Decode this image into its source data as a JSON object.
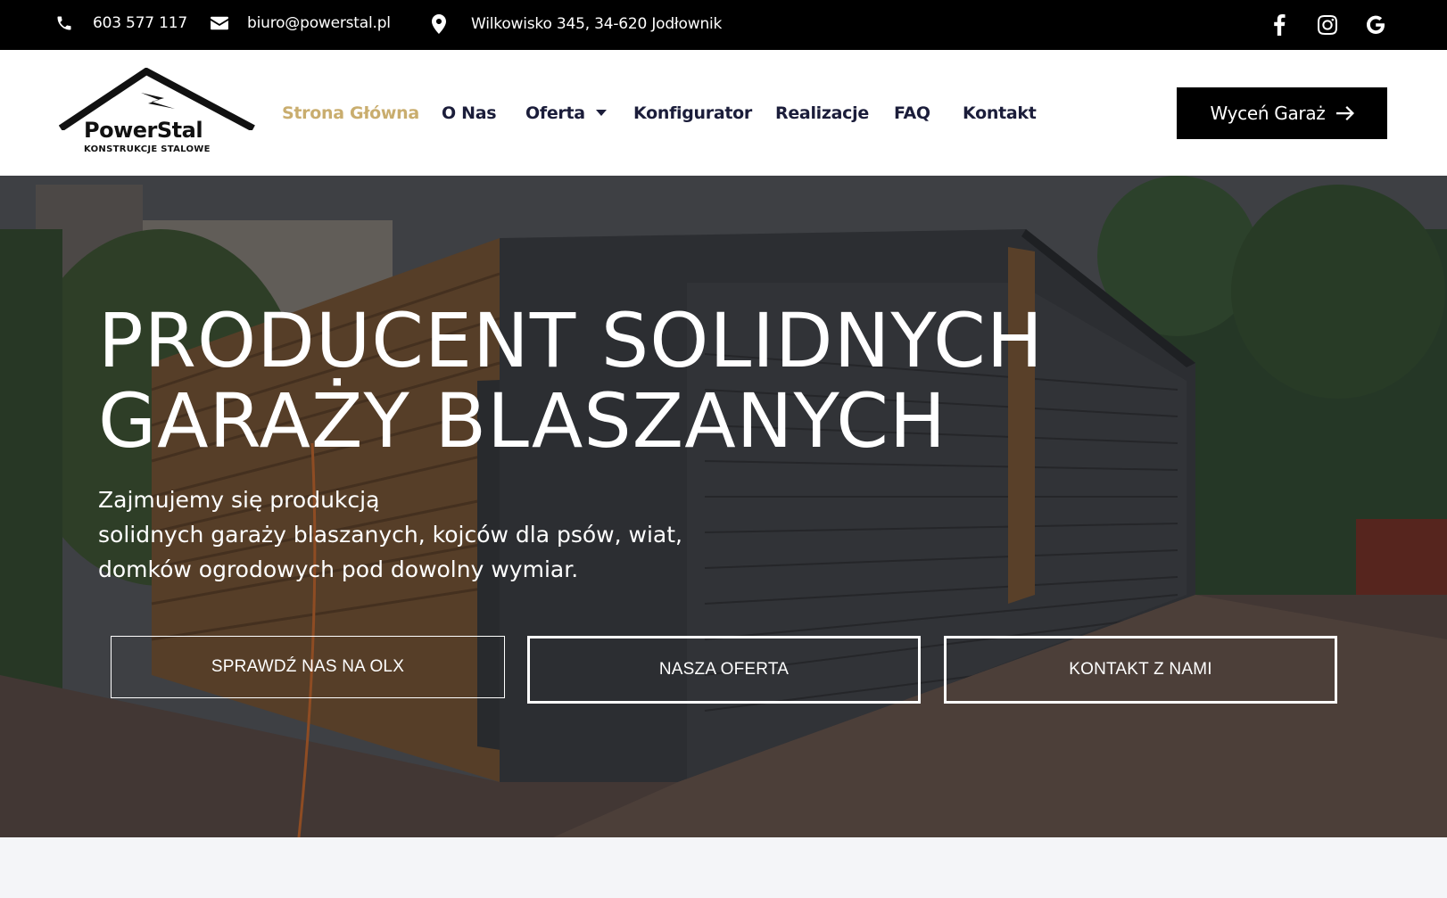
{
  "topbar": {
    "phone": "603 577 117",
    "email": "biuro@powerstal.pl",
    "address": "Wilkowisko 345, 34-620 Jodłownik"
  },
  "logo": {
    "brand": "PowerStal",
    "tagline": "KONSTRUKCJE STALOWE"
  },
  "nav": {
    "items": [
      {
        "label": "Strona Główna",
        "active": true
      },
      {
        "label": "O Nas"
      },
      {
        "label": "Oferta",
        "dropdown": true
      },
      {
        "label": "Konfigurator"
      },
      {
        "label": "Realizacje"
      },
      {
        "label": "FAQ"
      },
      {
        "label": "Kontakt"
      }
    ],
    "cta": "Wyceń Garaż"
  },
  "hero": {
    "title_line1": "PRODUCENT SOLIDNYCH",
    "title_line2": "GARAŻY BLASZANYCH",
    "sub_line1": "Zajmujemy się produkcją",
    "sub_line2": "solidnych garaży blaszanych, kojców dla psów, wiat,",
    "sub_line3": "domków ogrodowych pod dowolny wymiar.",
    "buttons": [
      "SPRAWDŹ NAS NA OLX",
      "NASZA OFERTA",
      "KONTAKT Z NAMI"
    ]
  },
  "colors": {
    "accent": "#c9ad6e",
    "nav_text": "#1b1d3a",
    "topbar_bg": "#000000"
  }
}
